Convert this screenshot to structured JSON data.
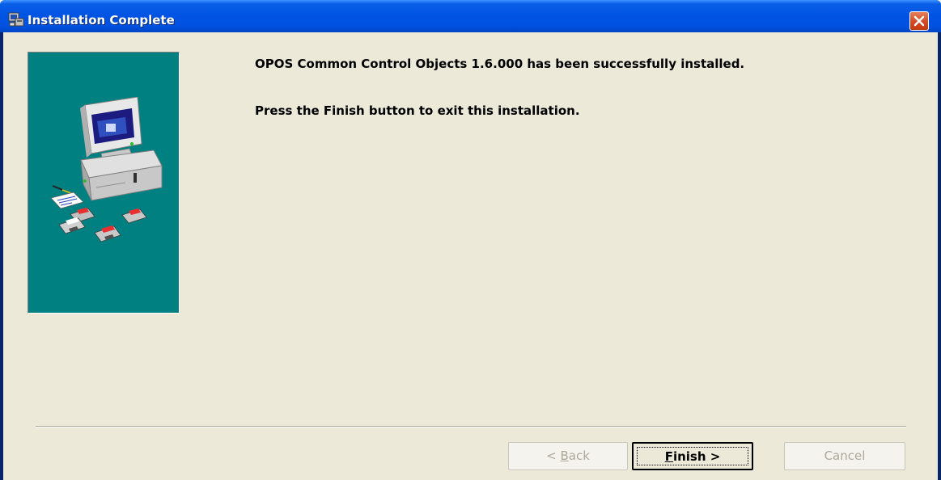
{
  "window": {
    "title": "Installation Complete",
    "title_icon": "setup-computer-icon",
    "close_icon": "close-icon"
  },
  "content": {
    "message_installed": "OPOS Common Control Objects 1.6.000 has been successfully installed.",
    "message_instruction": "Press the Finish button to exit this installation.",
    "side_image": "computer-with-floppy-disks-illustration"
  },
  "buttons": {
    "back_prefix": "< ",
    "back_accel": "B",
    "back_rest": "ack",
    "finish_accel": "F",
    "finish_rest": "inish >",
    "cancel_label": "Cancel"
  },
  "colors": {
    "titlebar": "#0054e3",
    "dialog_bg": "#ece9d8",
    "side_panel": "#008080",
    "close_button": "#d24a22"
  }
}
